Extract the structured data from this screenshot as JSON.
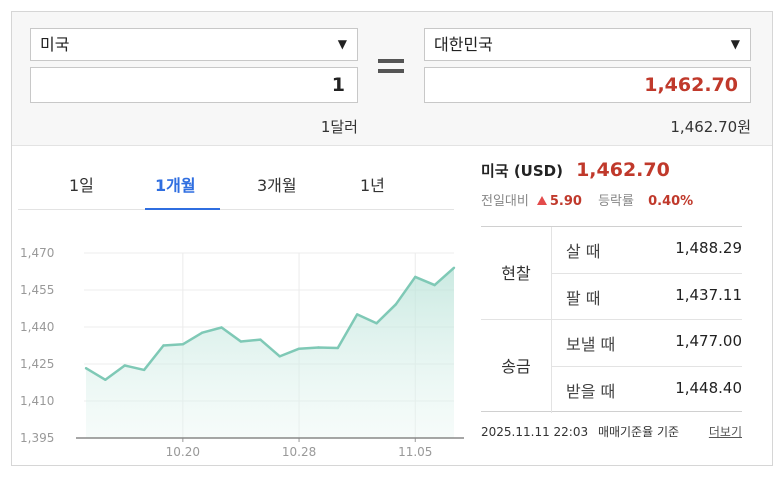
{
  "converter": {
    "from_currency": "미국",
    "to_currency": "대한민국",
    "from_amount": "1",
    "to_amount": "1,462.70",
    "from_unit": "1달러",
    "to_unit": "1,462.70원"
  },
  "tabs": [
    {
      "label": "1일",
      "active": false
    },
    {
      "label": "1개월",
      "active": true
    },
    {
      "label": "3개월",
      "active": false
    },
    {
      "label": "1년",
      "active": false
    }
  ],
  "rate": {
    "title": "미국 (USD)",
    "value": "1,462.70",
    "change_label": "전일대비",
    "change_value": "5.90",
    "rate_label": "등락률",
    "rate_value": "0.40%"
  },
  "table": {
    "cash": {
      "label": "현찰",
      "buy_label": "살 때",
      "buy_value": "1,488.29",
      "sell_label": "팔 때",
      "sell_value": "1,437.11"
    },
    "wire": {
      "label": "송금",
      "send_label": "보낼 때",
      "send_value": "1,477.00",
      "receive_label": "받을 때",
      "receive_value": "1,448.40"
    }
  },
  "footer": {
    "timestamp": "2025.11.11 22:03",
    "basis": "매매기준율 기준",
    "more": "더보기"
  },
  "colors": {
    "accent": "#2f6ee0",
    "up": "#c0392b",
    "line": "#7fc9b6"
  },
  "chart_data": {
    "type": "area",
    "y_ticks": [
      "1,470",
      "1,455",
      "1,440",
      "1,425",
      "1,410",
      "1,395"
    ],
    "x_ticks": [
      {
        "label": "10.20",
        "index": 5
      },
      {
        "label": "10.28",
        "index": 11
      },
      {
        "label": "11.05",
        "index": 17
      }
    ],
    "ylim": [
      1395,
      1470
    ],
    "values": [
      1423.3,
      1418.6,
      1424.4,
      1422.6,
      1432.5,
      1433.0,
      1437.7,
      1439.8,
      1434.1,
      1434.9,
      1428.1,
      1431.2,
      1431.7,
      1431.5,
      1445.1,
      1441.5,
      1449.2,
      1460.3,
      1457.0,
      1464.0
    ],
    "grid": true
  }
}
